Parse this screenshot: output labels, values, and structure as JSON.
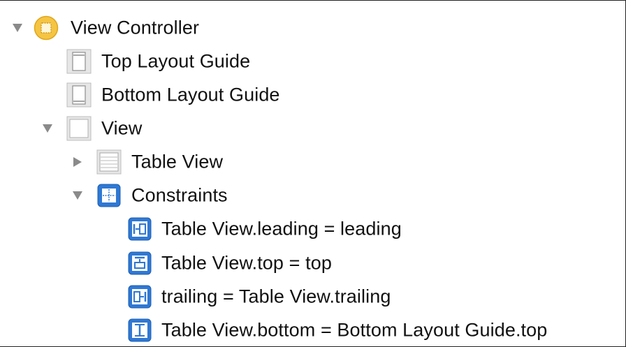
{
  "outline": {
    "view_controller": {
      "label": "View Controller",
      "icon": "view-controller-icon",
      "expanded": true
    },
    "top_layout_guide": {
      "label": "Top Layout Guide",
      "icon": "top-layout-guide-icon"
    },
    "bottom_layout_guide": {
      "label": "Bottom Layout Guide",
      "icon": "bottom-layout-guide-icon"
    },
    "view": {
      "label": "View",
      "icon": "view-icon",
      "expanded": true
    },
    "table_view": {
      "label": "Table View",
      "icon": "table-view-icon",
      "expanded": false
    },
    "constraints": {
      "label": "Constraints",
      "icon": "constraints-icon",
      "expanded": true,
      "items": [
        {
          "label": "Table View.leading = leading",
          "icon": "leading-constraint-icon"
        },
        {
          "label": "Table View.top = top",
          "icon": "top-constraint-icon"
        },
        {
          "label": "trailing = Table View.trailing",
          "icon": "trailing-constraint-icon"
        },
        {
          "label": "Table View.bottom = Bottom Layout Guide.top",
          "icon": "bottom-constraint-icon"
        }
      ]
    }
  },
  "colors": {
    "disclosure": "#8a8a8a",
    "vc_icon_fill": "#f5c542",
    "vc_icon_border": "#e0a51c",
    "constraint_blue": "#2f78d4",
    "guide_gray": "#e6e6e6",
    "text": "#111111"
  }
}
